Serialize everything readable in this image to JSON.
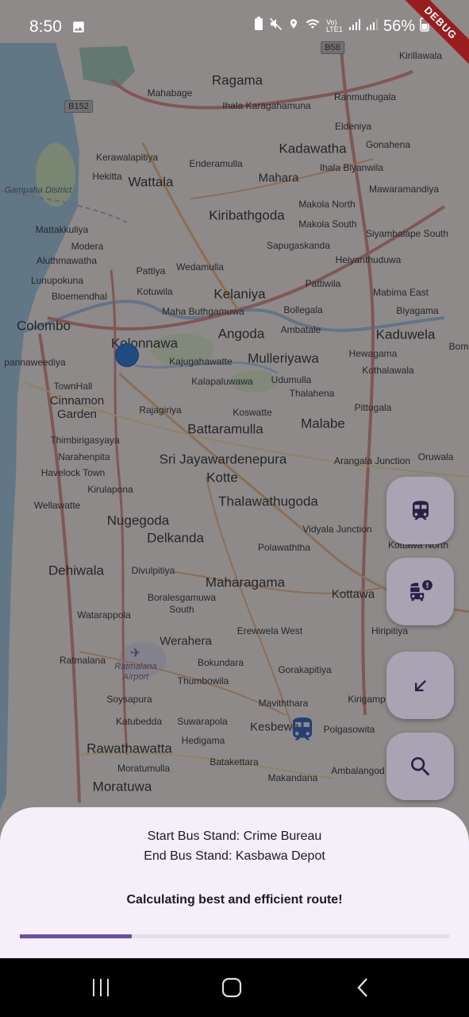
{
  "status_bar": {
    "time": "8:50",
    "network_label": "Vo) LTE1",
    "battery": "56%"
  },
  "debug_banner": "DEBUG",
  "map": {
    "region_labels": [
      "Gampaha District"
    ],
    "road_shields": [
      "B152",
      "B58"
    ],
    "place_labels": [
      "Kirillawala",
      "Ragama",
      "Mahabage",
      "Ihala Karagahamuna",
      "Ranmuthugala",
      "Eldeniya",
      "Kerawalapitiya",
      "Kadawatha",
      "Gonahena",
      "Enderamulla",
      "Ihala Biyanwila",
      "Wattala",
      "Mahara",
      "Mawaramandiya",
      "Hekitta",
      "Makola North",
      "Kiribathgoda",
      "Mattakkuliya",
      "Makola South",
      "Siyambalape South",
      "Modera",
      "Sapugaskanda",
      "Aluthmawatha",
      "Pattiya",
      "Wedamulla",
      "Heiyanthuduwa",
      "Lunupokuna",
      "Kotuwila",
      "Kelaniya",
      "Pattiwila",
      "Mabima East",
      "Bloemendhal",
      "Maha Buthgamuwa",
      "Bollegala",
      "Biyagama",
      "Colombo",
      "Kolonnawa",
      "Angoda",
      "Ambatale",
      "Kaduwela",
      "Bom",
      "pannaweediya",
      "Kajugahawatte",
      "Mulleriyawa",
      "Hewagama",
      "TownHall",
      "Kalapaluwawa",
      "Udumulla",
      "Kothalawala",
      "Cinnamon Garden",
      "Rajagiriya",
      "Thalahena",
      "Pittugala",
      "Koswatte",
      "Malabe",
      "Battaramulla",
      "Thimbirigasyaya",
      "Narahenpita",
      "Sri Jayawardenepura",
      "Arangala Junction",
      "Oruwala",
      "Havelock Town",
      "Kotte",
      "Kirulapona",
      "Wellawatte",
      "Thalawathugoda",
      "Nugegoda",
      "Vidyala Junction",
      "Kottawa North",
      "Delkanda",
      "Polawaththa",
      "Dehiwala",
      "Divulpitiya",
      "Maharagama",
      "Kottawa",
      "Boralesgamuwa South",
      "Watarappola",
      "Hiripitiya",
      "Erewwela West",
      "Werahera",
      "Ratmalana",
      "Bokundara",
      "Gorakapitiya",
      "Thumbowila",
      "Kirigamp",
      "Soysapura",
      "Maviththara",
      "Katubedda",
      "Suwarapola",
      "Kesbewa",
      "Polgasowita",
      "Hedigama",
      "Rawathawatta",
      "Batakettara",
      "Ambalangod",
      "Moratumulla",
      "Makandana",
      "Moratuwa"
    ],
    "airport_label": "Ratmalana Airport"
  },
  "fabs": [
    {
      "icon": "train-icon"
    },
    {
      "icon": "bus-alert-icon"
    },
    {
      "icon": "arrow-south-west-icon"
    },
    {
      "icon": "search-icon"
    }
  ],
  "bottom_sheet": {
    "start_label": "Start Bus Stand: Crime Bureau",
    "end_label": "End Bus Stand: Kasbawa Depot",
    "status": "Calculating best and efficient route!",
    "progress": 0.26
  },
  "colors": {
    "accent": "#6750a4",
    "fab_bg": "#d9d1ea",
    "sheet_bg": "#f4eff8",
    "location_dot": "#1565c0",
    "bus_marker": "#1f4fa8"
  }
}
